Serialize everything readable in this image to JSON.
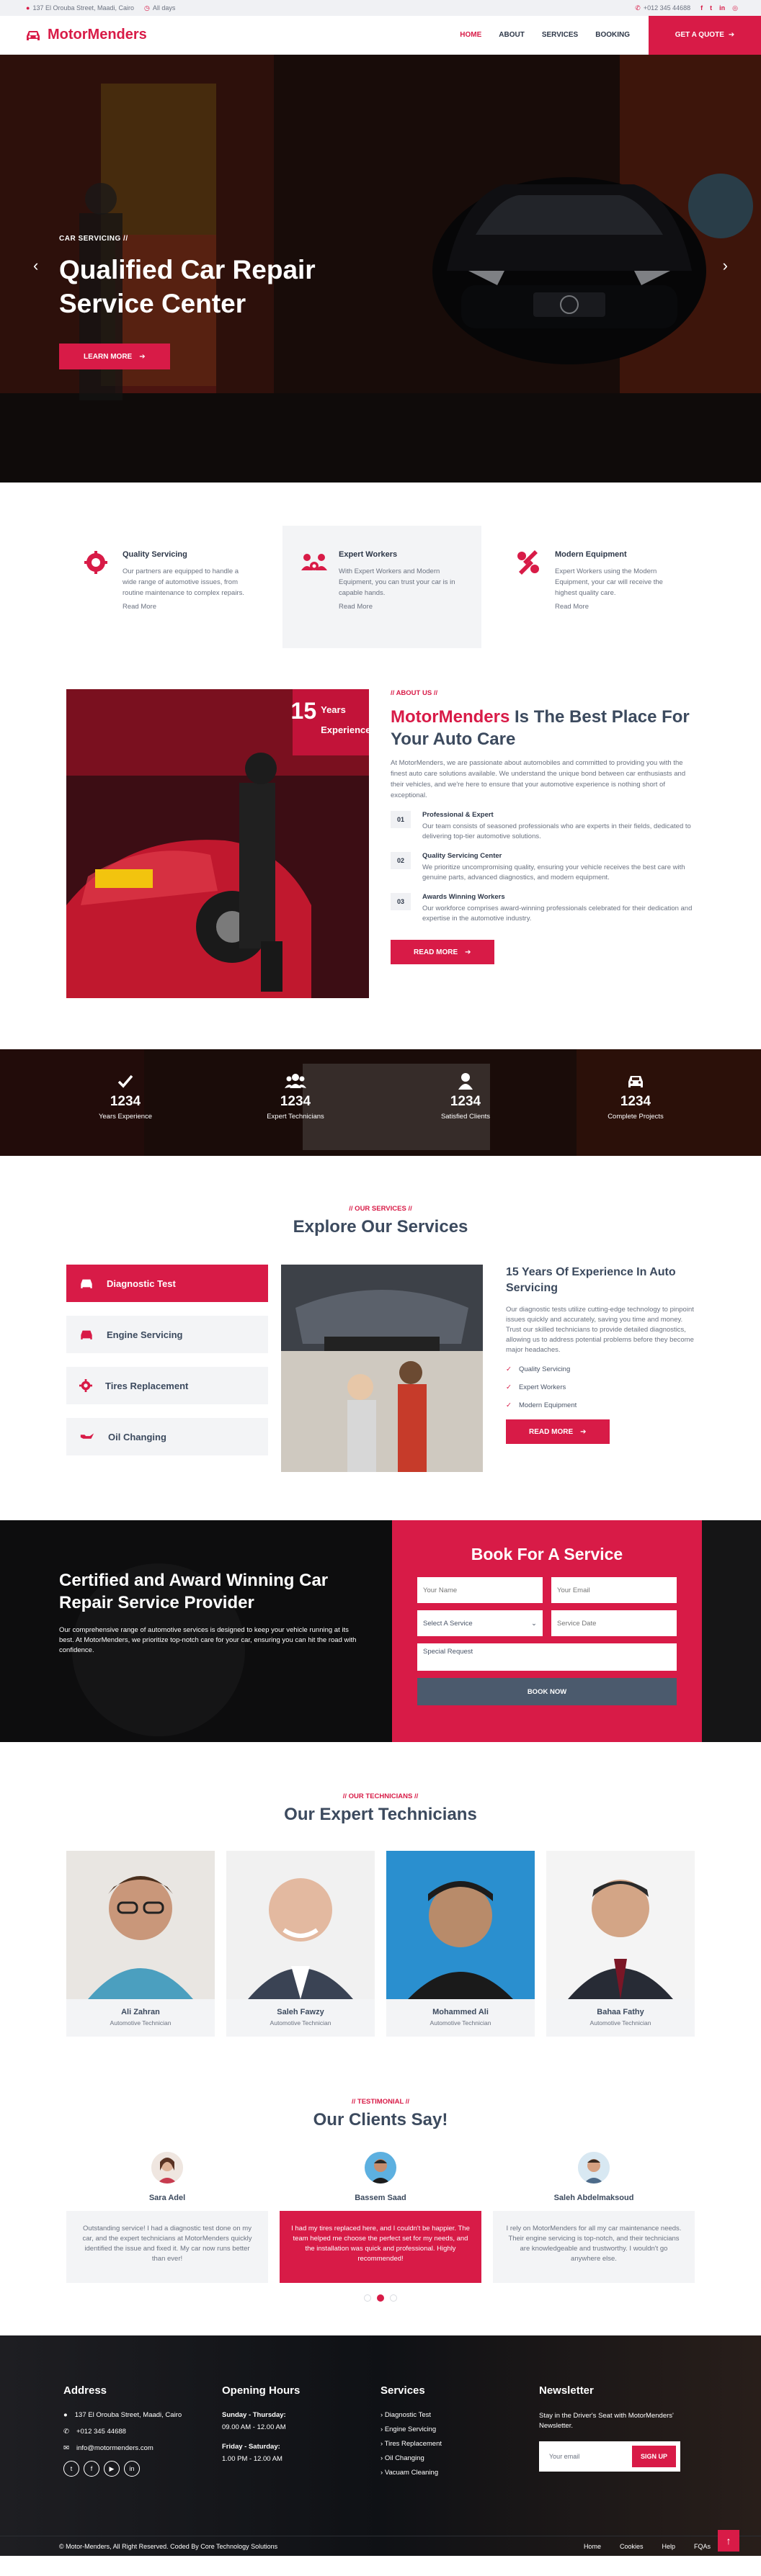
{
  "topbar": {
    "address": "137 El Orouba Street, Maadi, Cairo",
    "days": "All days",
    "phone": "+012 345 44688"
  },
  "brand": {
    "name": "MotorMenders",
    "color": "#d81b47"
  },
  "nav": {
    "items": [
      "HOME",
      "ABOUT",
      "SERVICES",
      "BOOKING"
    ],
    "quote": "GET A QUOTE"
  },
  "hero": {
    "eyebrow": "CAR SERVICING //",
    "title": "Qualified Car Repair Service Center",
    "button": "LEARN MORE"
  },
  "features": [
    {
      "icon": "gear-badge-icon",
      "title": "Quality Servicing",
      "text": "Our partners are equipped to handle a wide range of automotive issues, from routine maintenance to complex repairs.",
      "link": "Read More"
    },
    {
      "icon": "users-gear-icon",
      "title": "Expert Workers",
      "text": "With Expert Workers and Modern Equipment, you can trust your car is in capable hands.",
      "link": "Read More"
    },
    {
      "icon": "tools-icon",
      "title": "Modern Equipment",
      "text": "Expert Workers using the Modern Equipment, your car will receive the highest quality care.",
      "link": "Read More"
    }
  ],
  "about": {
    "badge_num": "15",
    "badge_text1": "Years",
    "badge_text2": "Experience",
    "eyebrow": "// ABOUT US //",
    "title_red": "MotorMenders",
    "title_rest": " Is The Best Place For Your Auto Care",
    "intro": "At MotorMenders, we are passionate about automobiles and committed to providing you with the finest auto care solutions available. We understand the unique bond between car enthusiasts and their vehicles, and we're here to ensure that your automotive experience is nothing short of exceptional.",
    "points": [
      {
        "num": "01",
        "title": "Professional & Expert",
        "text": "Our team consists of seasoned professionals who are experts in their fields, dedicated to delivering top-tier automotive solutions."
      },
      {
        "num": "02",
        "title": "Quality Servicing Center",
        "text": "We prioritize uncompromising quality, ensuring your vehicle receives the best care with genuine parts, advanced diagnostics, and modern equipment."
      },
      {
        "num": "03",
        "title": "Awards Winning Workers",
        "text": "Our workforce comprises award-winning professionals celebrated for their dedication and expertise in the automotive industry."
      }
    ],
    "button": "READ MORE"
  },
  "stats": [
    {
      "icon": "check-icon",
      "num": "1234",
      "label": "Years Experience"
    },
    {
      "icon": "users-icon",
      "num": "1234",
      "label": "Expert Technicians"
    },
    {
      "icon": "user-icon",
      "num": "1234",
      "label": "Satisfied Clients"
    },
    {
      "icon": "car-icon",
      "num": "1234",
      "label": "Complete Projects"
    }
  ],
  "services": {
    "eyebrow": "// OUR SERVICES //",
    "title": "Explore Our Services",
    "tabs": [
      {
        "icon": "car-icon",
        "label": "Diagnostic Test",
        "active": true
      },
      {
        "icon": "car-icon",
        "label": "Engine Servicing",
        "active": false
      },
      {
        "icon": "gear-icon",
        "label": "Tires Replacement",
        "active": false
      },
      {
        "icon": "oil-can-icon",
        "label": "Oil Changing",
        "active": false
      }
    ],
    "detail_title": "15 Years Of Experience In Auto Servicing",
    "detail_text": "Our diagnostic tests utilize cutting-edge technology to pinpoint issues quickly and accurately, saving you time and money. Trust our skilled technicians to provide detailed diagnostics, allowing us to address potential problems before they become major headaches.",
    "checks": [
      "Quality Servicing",
      "Expert Workers",
      "Modern Equipment"
    ],
    "button": "READ MORE"
  },
  "booking": {
    "title": "Certified and Award Winning Car Repair Service Provider",
    "text": "Our comprehensive range of automotive services is designed to keep your vehicle running at its best. At MotorMenders, we prioritize top-notch care for your car, ensuring you can hit the road with confidence.",
    "form_title": "Book For A Service",
    "name_placeholder": "Your Name",
    "email_placeholder": "Your Email",
    "select_value": "Select A Service",
    "date_placeholder": "Service Date",
    "request_placeholder": "Special Request",
    "button": "BOOK NOW"
  },
  "team": {
    "eyebrow": "// OUR TECHNICIANS //",
    "title": "Our Expert Technicians",
    "members": [
      {
        "name": "Ali Zahran",
        "role": "Automotive Technician"
      },
      {
        "name": "Saleh Fawzy",
        "role": "Automotive Technician"
      },
      {
        "name": "Mohammed Ali",
        "role": "Automotive Technician"
      },
      {
        "name": "Bahaa Fathy",
        "role": "Automotive Technician"
      }
    ]
  },
  "testimonials": {
    "eyebrow": "// TESTIMONIAL //",
    "title": "Our Clients Say!",
    "items": [
      {
        "name": "Sara Adel",
        "text": "Outstanding service! I had a diagnostic test done on my car, and the expert technicians at MotorMenders quickly identified the issue and fixed it. My car now runs better than ever!"
      },
      {
        "name": "Bassem Saad",
        "text": "I had my tires replaced here, and I couldn't be happier. The team helped me choose the perfect set for my needs, and the installation was quick and professional. Highly recommended!"
      },
      {
        "name": "Saleh Abdelmaksoud",
        "text": "I rely on MotorMenders for all my car maintenance needs. Their engine servicing is top-notch, and their technicians are knowledgeable and trustworthy. I wouldn't go anywhere else."
      }
    ]
  },
  "footer": {
    "address_title": "Address",
    "address": "137 El Orouba Street, Maadi, Cairo",
    "phone": "+012 345 44688",
    "email": "info@motormenders.com",
    "hours_title": "Opening Hours",
    "hours1_days": "Sunday - Thursday:",
    "hours1_time": "09.00 AM - 12.00 AM",
    "hours2_days": "Friday - Saturday:",
    "hours2_time": "1.00 PM - 12.00 AM",
    "services_title": "Services",
    "services": [
      "Diagnostic Test",
      "Engine Servicing",
      "Tires Replacement",
      "Oil Changing",
      "Vacuam Cleaning"
    ],
    "newsletter_title": "Newsletter",
    "newsletter_text": "Stay in the Driver's Seat with MotorMenders' Newsletter.",
    "email_placeholder": "Your email",
    "signup": "SIGN UP",
    "copyright": "© Motor-Menders, All Right Reserved. Coded By Core Technology Solutions",
    "links": [
      "Home",
      "Cookies",
      "Help",
      "FQAs"
    ]
  }
}
